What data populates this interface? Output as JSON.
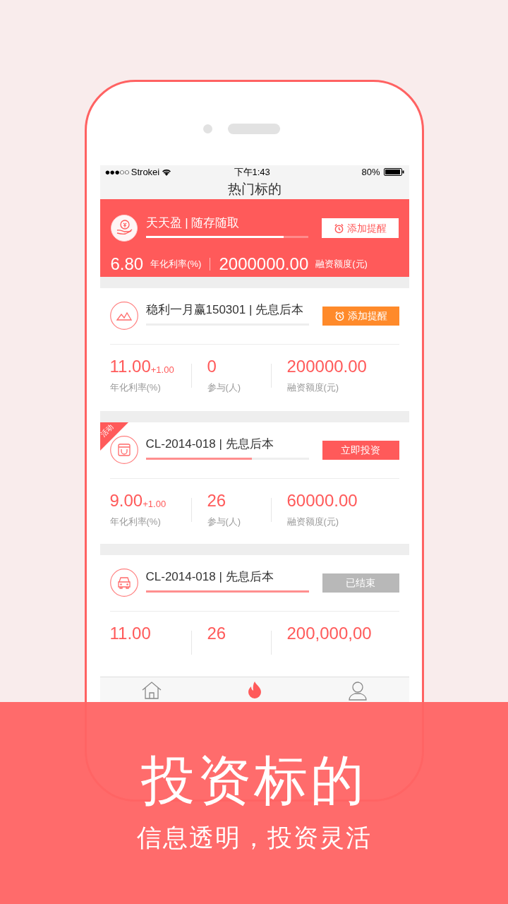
{
  "status_bar": {
    "signal": "●●●○○",
    "carrier": "Strokei",
    "time": "下午1:43",
    "battery": "80%"
  },
  "nav_title": "热门标的",
  "featured": {
    "title": "天天盈 | 随存随取",
    "level": 0.85,
    "button": "添加提醒",
    "rate": "6.80",
    "rate_label": "年化利率(%)",
    "amount": "2000000.00",
    "amount_label": "融资额度(元)"
  },
  "products": [
    {
      "title": "稳利一月赢150301 | 先息后本",
      "level": 0,
      "button": {
        "kind": "remind",
        "label": "添加提醒"
      },
      "stats": [
        {
          "value": "11.00",
          "bonus": "+1.00",
          "label": "年化利率(%)"
        },
        {
          "value": "0",
          "label": "参与(人)"
        },
        {
          "value": "200000.00",
          "label": "融资额度(元)"
        }
      ]
    },
    {
      "badge": "活动",
      "title": "CL-2014-018 | 先息后本",
      "level": 0.65,
      "button": {
        "kind": "invest",
        "label": "立即投资"
      },
      "stats": [
        {
          "value": "9.00",
          "bonus": "+1.00",
          "label": "年化利率(%)"
        },
        {
          "value": "26",
          "label": "参与(人)"
        },
        {
          "value": "60000.00",
          "label": "融资额度(元)"
        }
      ]
    },
    {
      "title": "CL-2014-018 | 先息后本",
      "level": 1,
      "button": {
        "kind": "ended",
        "label": "已结束"
      },
      "stats": [
        {
          "value": "11.00"
        },
        {
          "value": "26"
        },
        {
          "value": "200,000,00"
        }
      ]
    }
  ],
  "tabs": [
    {
      "selected": false
    },
    {
      "selected": true
    },
    {
      "selected": false
    }
  ],
  "banner": {
    "title": "投资标的",
    "subtitle": "信息透明，投资灵活"
  }
}
